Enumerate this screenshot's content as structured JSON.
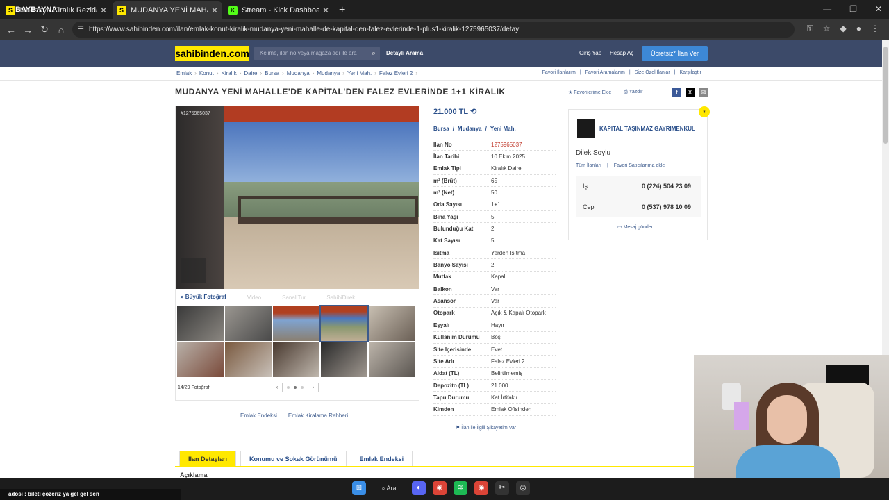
{
  "browser": {
    "tabs": [
      {
        "title": "Mudanya Kiralık Rezidans, Villa",
        "favicon": "S",
        "active": false
      },
      {
        "title": "MUDANYA YENİ MAHALLE'DE KAPİTAL",
        "favicon": "S",
        "active": true
      },
      {
        "title": "Stream - Kick Dashboard",
        "favicon": "K",
        "active": false
      }
    ],
    "url": "https://www.sahibinden.com/ilan/emlak-konut-kiralik-mudanya-yeni-mahalle-de-kapital-den-falez-evlerinde-1-plus1-kiralik-1275965037/detay",
    "overlay_text": "BAYBAYNA"
  },
  "site": {
    "logo": "sahibinden.com",
    "search_placeholder": "Kelime, ilan no veya mağaza adı ile ara",
    "detailed_search": "Detaylı Arama",
    "login": "Giriş Yap",
    "register": "Hesap Aç",
    "post_ad": "Ücretsiz* İlan Ver"
  },
  "breadcrumbs": [
    "Emlak",
    "Konut",
    "Kiralık",
    "Daire",
    "Bursa",
    "Mudanya",
    "Mudanya",
    "Yeni Mah.",
    "Falez Evleri 2"
  ],
  "right_links": [
    "Favori İlanlarım",
    "Favori Aramalarım",
    "Size Özel İlanlar",
    "Karşılaştır"
  ],
  "listing": {
    "title": "MUDANYA YENİ MAHALLE'DE KAPİTAL'DEN FALEZ EVLERİNDE 1+1 KİRALIK",
    "favorite": "Favorilerime Ekle",
    "print": "Yazdır",
    "photo_id": "#1275965037",
    "photo_tools": [
      "Büyük Fotoğraf",
      "Video",
      "Sanal Tur",
      "SahibiDirek"
    ],
    "photo_counter": "14/29 Fotoğraf",
    "bottom_links": [
      "Emlak Endeksi",
      "Emlak Kiralama Rehberi"
    ],
    "price": "21.000 TL",
    "location": [
      "Bursa",
      "Mudanya",
      "Yeni Mah."
    ],
    "specs": [
      {
        "k": "İlan No",
        "v": "1275965037"
      },
      {
        "k": "İlan Tarihi",
        "v": "10 Ekim 2025"
      },
      {
        "k": "Emlak Tipi",
        "v": "Kiralık Daire"
      },
      {
        "k": "m² (Brüt)",
        "v": "65"
      },
      {
        "k": "m² (Net)",
        "v": "50"
      },
      {
        "k": "Oda Sayısı",
        "v": "1+1"
      },
      {
        "k": "Bina Yaşı",
        "v": "5"
      },
      {
        "k": "Bulunduğu Kat",
        "v": "2"
      },
      {
        "k": "Kat Sayısı",
        "v": "5"
      },
      {
        "k": "Isıtma",
        "v": "Yerden Isıtma"
      },
      {
        "k": "Banyo Sayısı",
        "v": "2"
      },
      {
        "k": "Mutfak",
        "v": "Kapalı"
      },
      {
        "k": "Balkon",
        "v": "Var"
      },
      {
        "k": "Asansör",
        "v": "Var"
      },
      {
        "k": "Otopark",
        "v": "Açık & Kapalı Otopark"
      },
      {
        "k": "Eşyalı",
        "v": "Hayır"
      },
      {
        "k": "Kullanım Durumu",
        "v": "Boş"
      },
      {
        "k": "Site İçerisinde",
        "v": "Evet"
      },
      {
        "k": "Site Adı",
        "v": "Falez Evleri 2"
      },
      {
        "k": "Aidat (TL)",
        "v": "Belirtilmemiş"
      },
      {
        "k": "Depozito (TL)",
        "v": "21.000"
      },
      {
        "k": "Tapu Durumu",
        "v": "Kat İrtifaklı"
      },
      {
        "k": "Kimden",
        "v": "Emlak Ofisinden"
      }
    ],
    "complaint": "İlan ile İlgili Şikayetim Var"
  },
  "seller": {
    "company": "KAPİTAL TAŞINMAZ GAYRİMENKUL",
    "agent": "Dilek Soylu",
    "all_listings": "Tüm İlanları",
    "fav_seller": "Favori Satıcılarıma ekle",
    "phones": [
      {
        "label": "İş",
        "number": "0 (224) 504 23 09"
      },
      {
        "label": "Cep",
        "number": "0 (537) 978 10 09"
      }
    ],
    "message": "Mesaj gönder"
  },
  "page_tabs": [
    "İlan Detayları",
    "Konumu ve Sokak Görünümü",
    "Emlak Endeksi"
  ],
  "description_heading": "Açıklama",
  "chat_line": "adosi : bileti çözeriz ya gel gel sen",
  "taskbar_search": "Ara"
}
